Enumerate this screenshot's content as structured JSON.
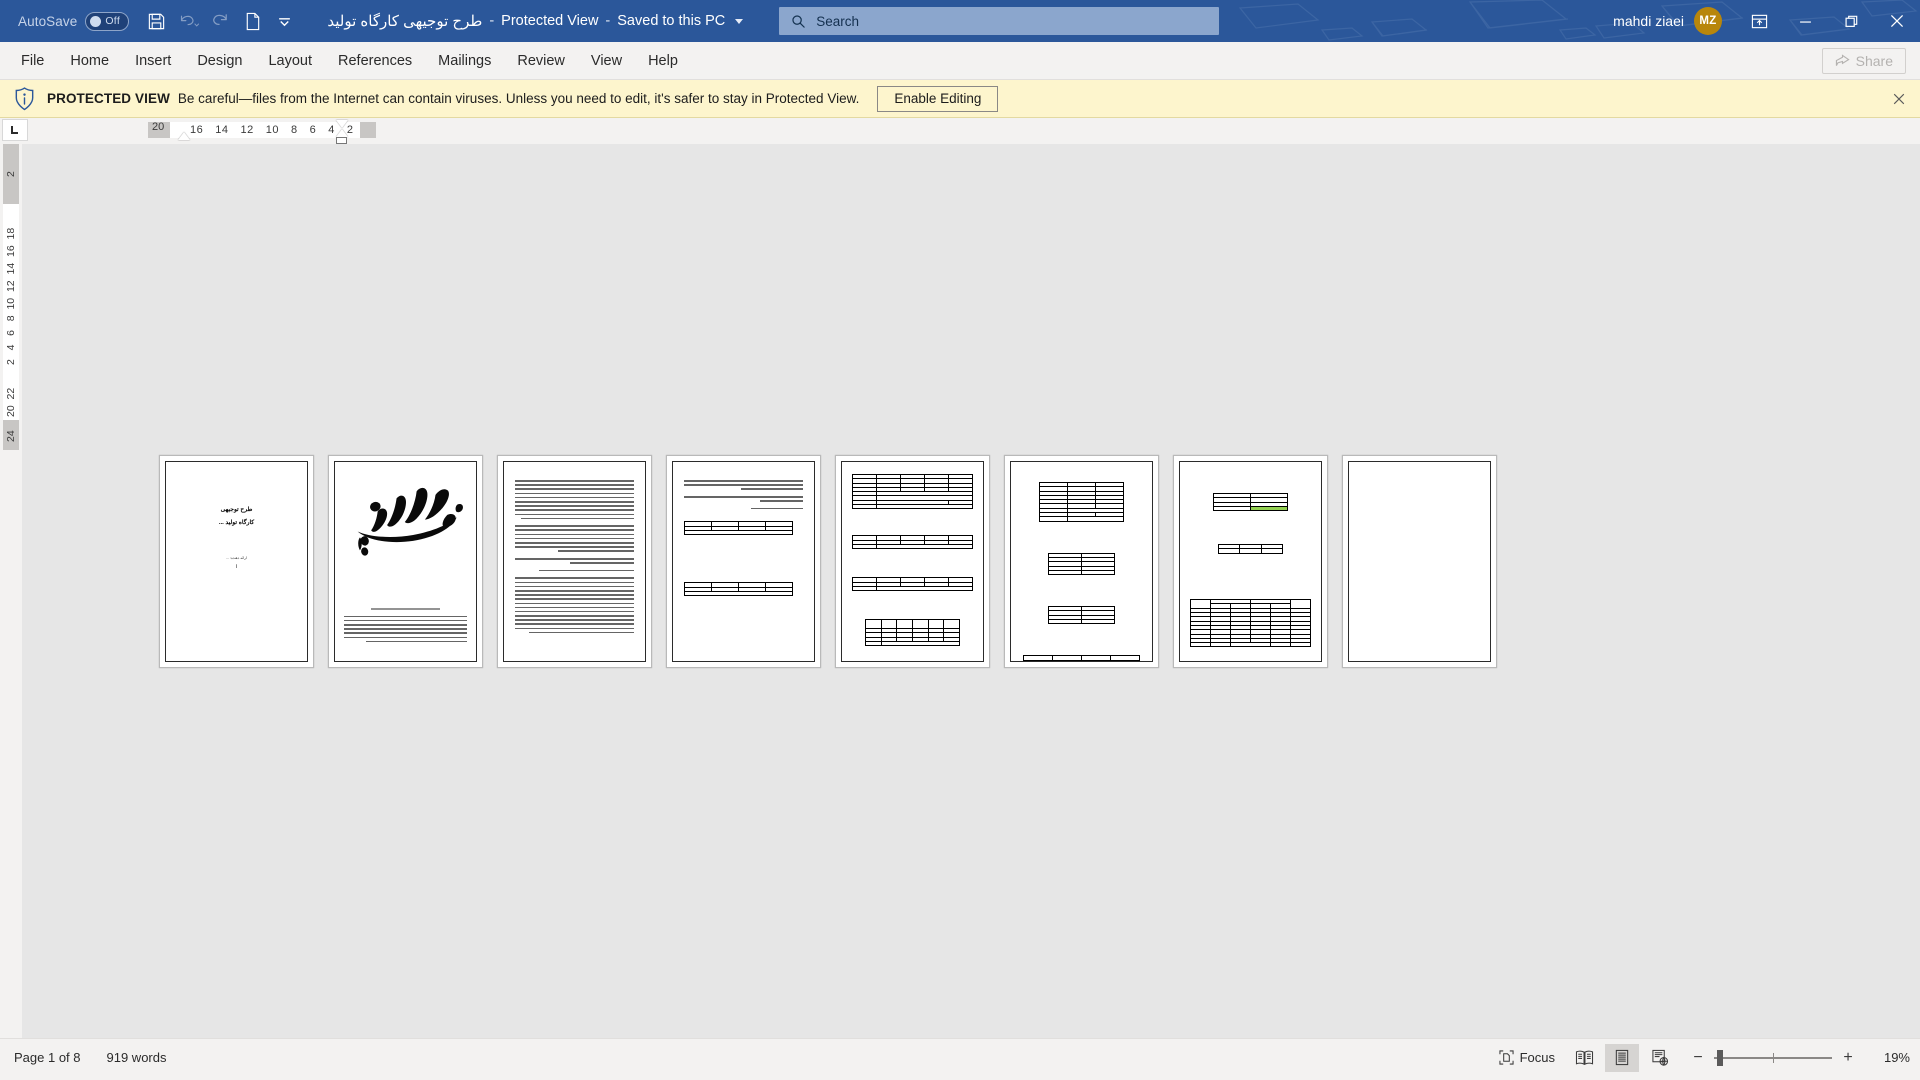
{
  "titlebar": {
    "autosave_label": "AutoSave",
    "autosave_state": "Off",
    "quick_access": [
      {
        "name": "save-button",
        "icon": "save-icon",
        "enabled": true
      },
      {
        "name": "undo-button",
        "icon": "undo-icon",
        "enabled": false
      },
      {
        "name": "redo-button",
        "icon": "redo-icon",
        "enabled": false
      },
      {
        "name": "new-document-button",
        "icon": "page-icon",
        "enabled": true
      },
      {
        "name": "customize-quick-access-button",
        "icon": "chevron-down-icon",
        "enabled": true
      }
    ],
    "document_name": "طرح توجیهی کارگاه تولید",
    "separator": "-",
    "protected_view_label": "Protected View",
    "save_location": "Saved to this PC",
    "search_placeholder": "Search",
    "account_name": "mahdi ziaei",
    "avatar_initials": "MZ",
    "ribbon_display_options": "Ribbon Display Options",
    "minimize": "Minimize",
    "restore": "Restore Down",
    "close": "Close"
  },
  "ribbon": {
    "tabs": [
      {
        "label": "File"
      },
      {
        "label": "Home"
      },
      {
        "label": "Insert"
      },
      {
        "label": "Design"
      },
      {
        "label": "Layout"
      },
      {
        "label": "References"
      },
      {
        "label": "Mailings"
      },
      {
        "label": "Review"
      },
      {
        "label": "View"
      },
      {
        "label": "Help"
      }
    ],
    "share_label": "Share",
    "share_enabled": false
  },
  "protected_view": {
    "badge": "PROTECTED VIEW",
    "message": "Be careful—files from the Internet can contain viruses. Unless you need to edit, it's safer to stay in Protected View.",
    "button_label": "Enable Editing",
    "close_label": "×",
    "background_color": "#fdf5cd"
  },
  "ruler": {
    "horizontal_marks": [
      "20",
      "16",
      "14",
      "12",
      "10",
      "8",
      "6",
      "4",
      "2"
    ],
    "vertical_marks": [
      "2",
      "4",
      "6",
      "8",
      "10",
      "12",
      "14",
      "16",
      "18",
      "20",
      "22",
      "24"
    ],
    "vertical_top_mark": "2",
    "corner_tab_stop": "left-tab-stop"
  },
  "document": {
    "pages": [
      {
        "number": 1,
        "kind": "cover",
        "title_line1": "طرح توجیهی",
        "title_line2": "کارگاه تولید ...",
        "presenter_label": "ارائه دهنده: ...",
        "marker": "ا"
      },
      {
        "number": 2,
        "kind": "bismillah",
        "image_name": "bismillah-calligraphy",
        "heading": "بسم الله الرحمن الرحیم",
        "paragraph_lines": 7
      },
      {
        "number": 3,
        "kind": "text",
        "paragraphs": [
          10,
          4,
          2,
          1,
          14
        ]
      },
      {
        "number": 4,
        "kind": "text-and-tables",
        "top_paragraphs": [
          3,
          2,
          1
        ]
      },
      {
        "number": 5,
        "kind": "tables"
      },
      {
        "number": 6,
        "kind": "tables"
      },
      {
        "number": 7,
        "kind": "tables-highlighted"
      },
      {
        "number": 8,
        "kind": "blank"
      }
    ],
    "highlight_colors": {
      "light_green": "#92d050",
      "green": "#00b050"
    }
  },
  "statusbar": {
    "page_indicator": "Page 1 of 8",
    "word_count": "919 words",
    "focus_label": "Focus",
    "views": [
      {
        "name": "read-mode-button",
        "label": "Read Mode",
        "active": false
      },
      {
        "name": "print-layout-button",
        "label": "Print Layout",
        "active": true
      },
      {
        "name": "web-layout-button",
        "label": "Web Layout",
        "active": false
      }
    ],
    "zoom_out": "−",
    "zoom_in": "+",
    "zoom_level": "19%"
  },
  "colors": {
    "title_bar": "#2b579a",
    "accent": "#2b579a",
    "avatar": "#b8860b",
    "protected_view": "#fdf5cd",
    "canvas": "#e6e6e6"
  }
}
